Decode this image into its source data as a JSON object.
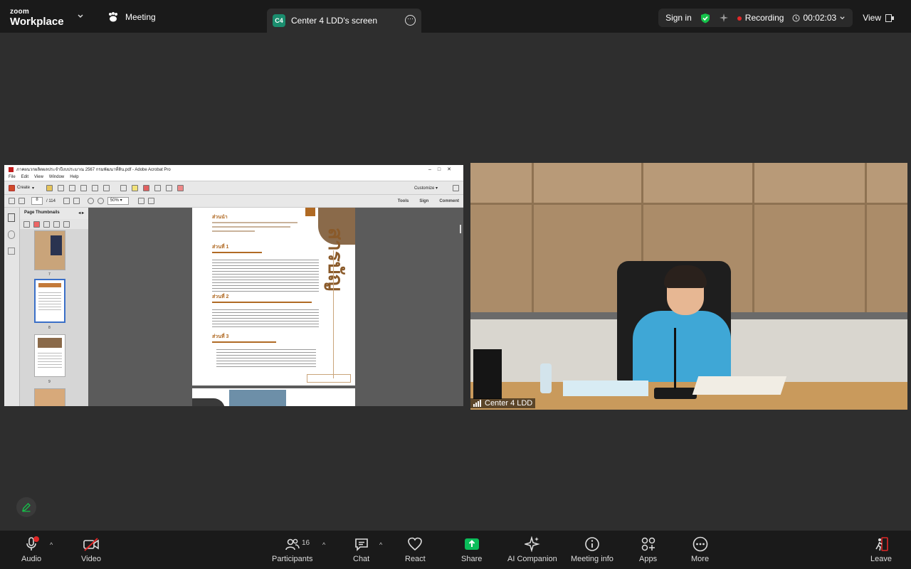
{
  "app": {
    "logo_top": "zoom",
    "logo_bottom": "Workplace",
    "meeting_label": "Meeting",
    "screen_tab": {
      "badge": "C4",
      "label": "Center 4 LDD's screen"
    },
    "sign_in": "Sign in",
    "recording_label": "Recording",
    "timer": "00:02:03",
    "view_label": "View"
  },
  "acrobat": {
    "title": "ภาคผนวกผลิตผลประจำปีงบประมาณ 2567 กรมพัฒนาที่ดิน.pdf - Adobe Acrobat Pro",
    "menu": [
      "File",
      "Edit",
      "View",
      "Window",
      "Help"
    ],
    "create_label": "Create",
    "customize_label": "Customize",
    "page_current": "8",
    "page_total": "/ 114",
    "zoom_value": "50%",
    "tools_label": "Tools",
    "sign_label": "Sign",
    "comment_label": "Comment",
    "thumb_panel_title": "Page Thumbnails",
    "thumb_numbers": [
      "7",
      "8",
      "9"
    ],
    "page_heading": "สารบัญ",
    "sections": [
      "ส่วนนำ",
      "ส่วนที่ 1",
      "ส่วนที่ 2",
      "ส่วนที่ 3"
    ]
  },
  "video": {
    "participant_name": "Center 4 LDD"
  },
  "toolbar": {
    "audio": "Audio",
    "video": "Video",
    "participants": "Participants",
    "participant_count": "16",
    "chat": "Chat",
    "react": "React",
    "share": "Share",
    "ai_companion": "AI Companion",
    "meeting_info": "Meeting info",
    "apps": "Apps",
    "more": "More",
    "leave": "Leave"
  },
  "colors": {
    "share_green": "#0bbd5a",
    "recording_red": "#e02828",
    "shield_green": "#15c24a"
  }
}
